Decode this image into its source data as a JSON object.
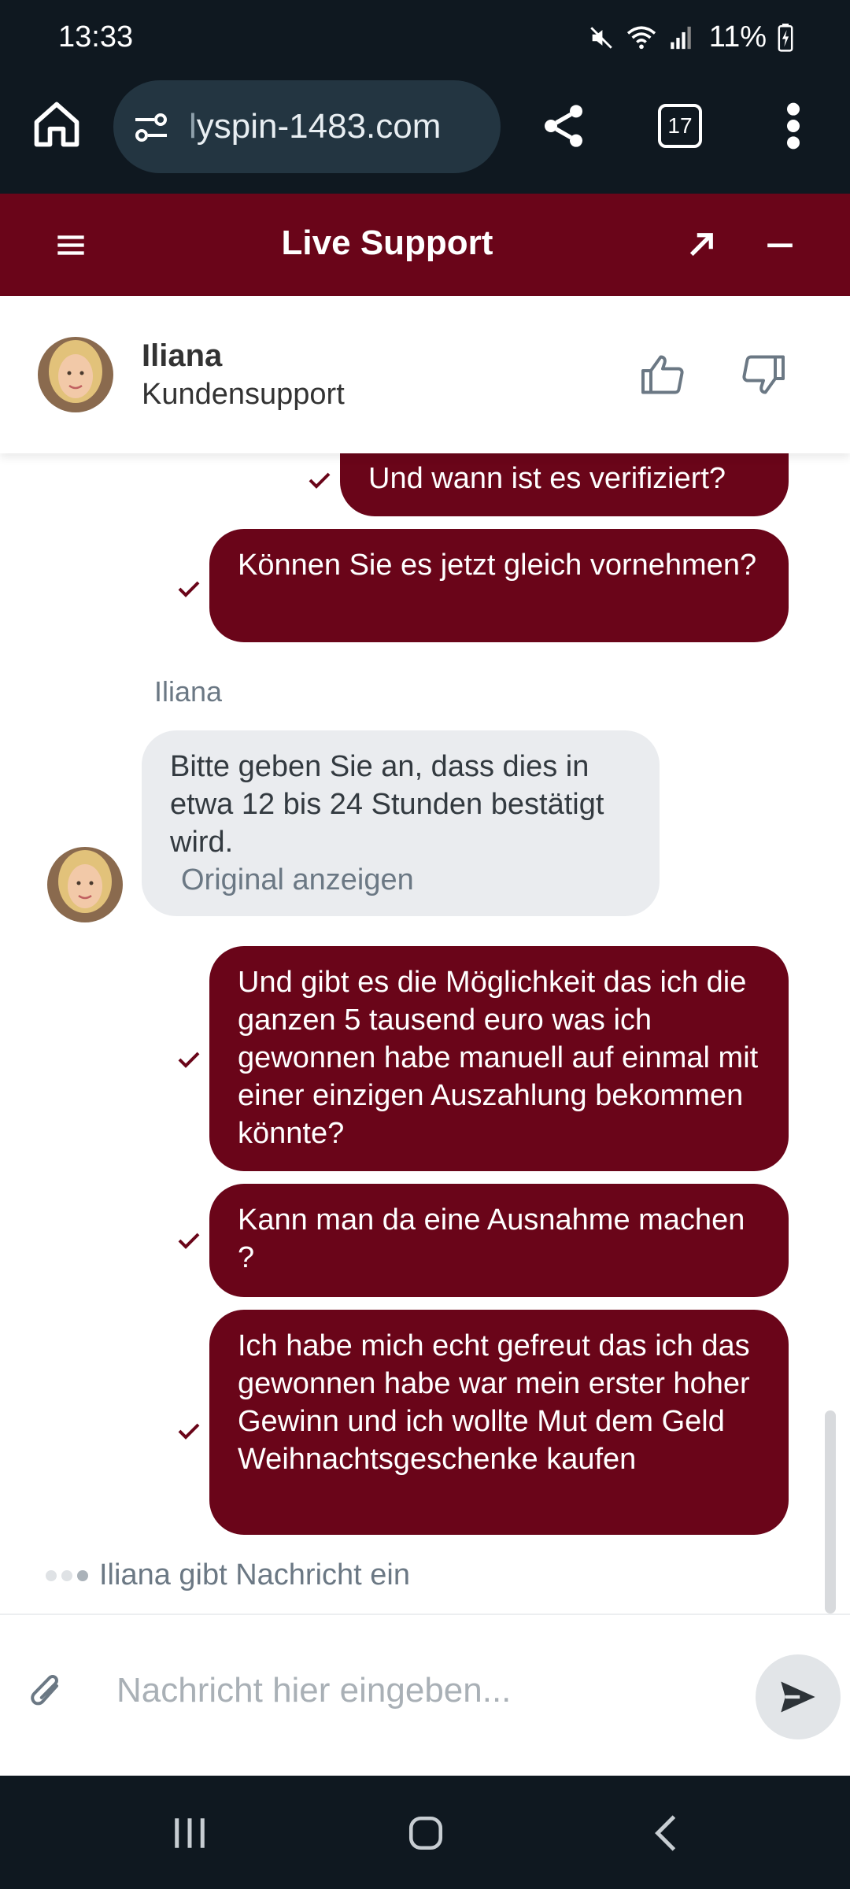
{
  "status_bar": {
    "time": "13:33",
    "battery": "11%"
  },
  "browser": {
    "url_fade": "l",
    "url_main": "yspin-1483.com",
    "tab_count": "17"
  },
  "chat_header": {
    "title": "Live Support"
  },
  "agent": {
    "name": "Iliana",
    "role": "Kundensupport"
  },
  "messages": [
    {
      "from": "user",
      "text": "Und wann ist es verifiziert?"
    },
    {
      "from": "user",
      "text": "Können Sie es jetzt gleich vornehmen?"
    },
    {
      "from": "agent",
      "sender": "Iliana",
      "text": "Bitte geben Sie an, dass dies in etwa 12 bis 24 Stunden bestätigt wird.",
      "link": "Original anzeigen"
    },
    {
      "from": "user",
      "text": "Und gibt es die Möglichkeit das ich die ganzen 5 tausend euro was ich gewonnen habe manuell auf einmal mit einer einzigen Auszahlung bekommen könnte?"
    },
    {
      "from": "user",
      "text": "Kann man da eine Ausnahme machen ?"
    },
    {
      "from": "user",
      "text": "Ich habe mich echt gefreut das ich das gewonnen habe war mein erster hoher Gewinn und ich wollte Mut dem Geld Weihnachtsgeschenke kaufen"
    }
  ],
  "typing_indicator": "Iliana gibt Nachricht ein",
  "composer": {
    "placeholder": "Nachricht hier eingeben..."
  },
  "colors": {
    "brand": "#6a0519",
    "browser_bg": "#0f1820",
    "incoming_bubble": "#eaecef"
  }
}
